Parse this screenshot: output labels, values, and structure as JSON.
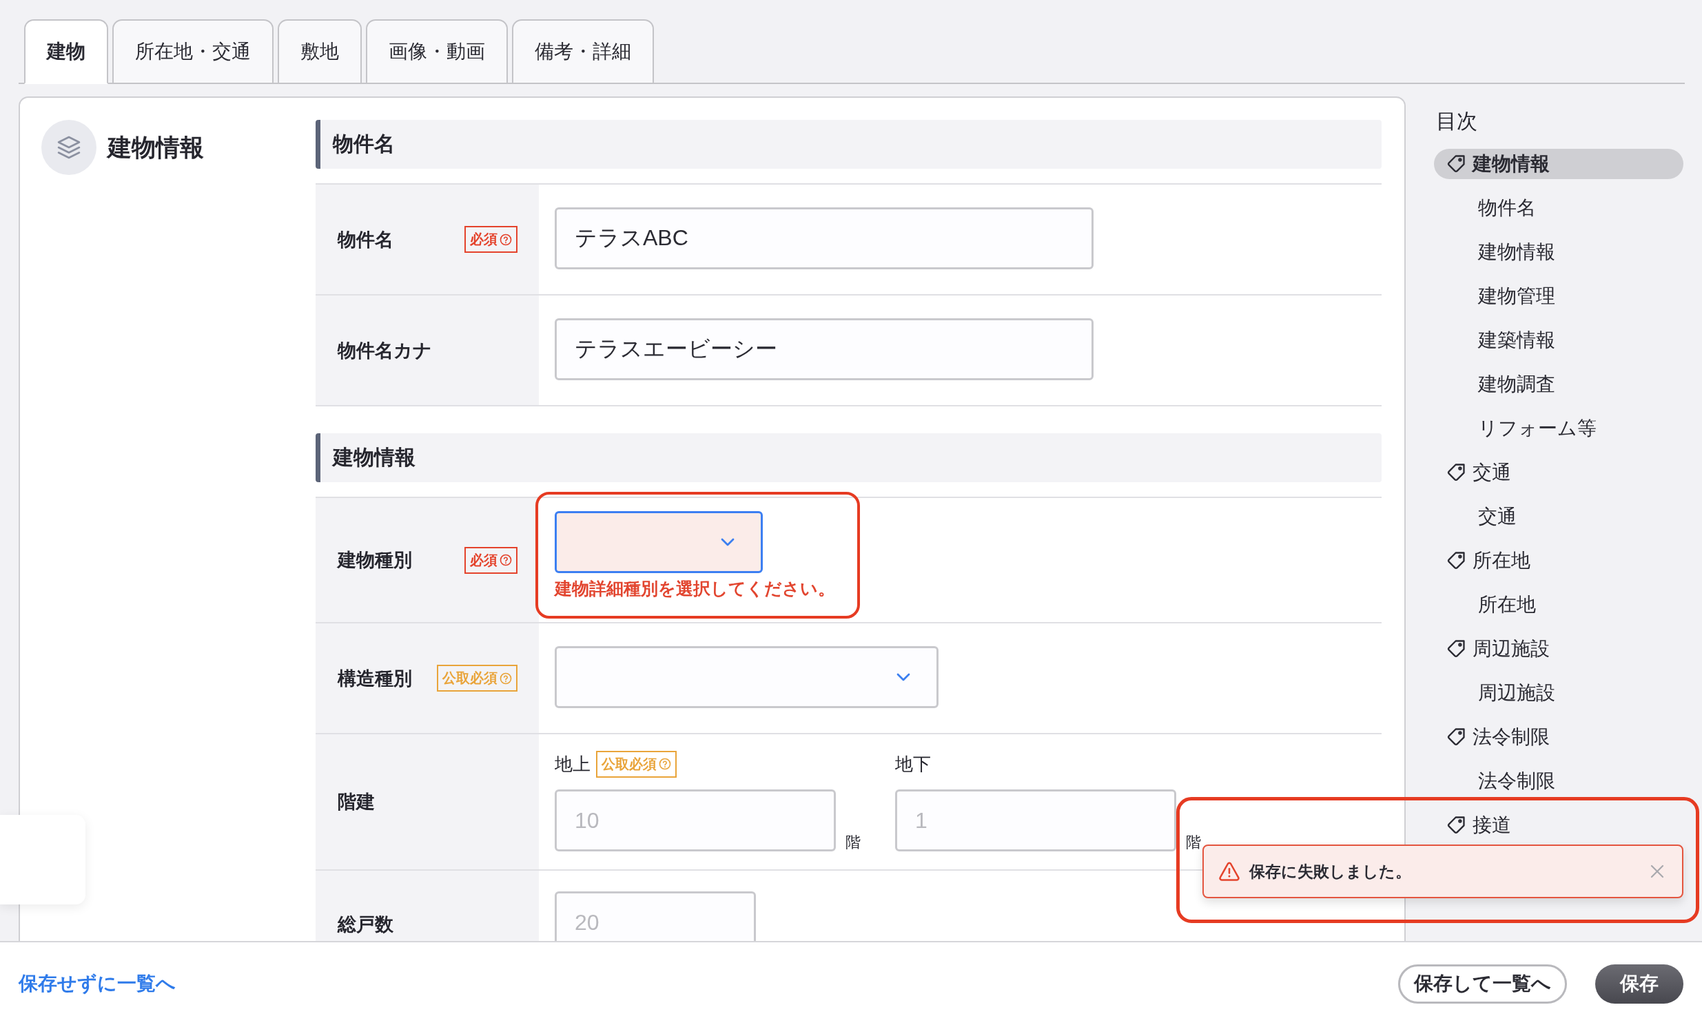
{
  "tabs": [
    {
      "label": "建物",
      "selected": true
    },
    {
      "label": "所在地・交通",
      "selected": false
    },
    {
      "label": "敷地",
      "selected": false
    },
    {
      "label": "画像・動画",
      "selected": false
    },
    {
      "label": "備考・詳細",
      "selected": false
    }
  ],
  "panel": {
    "title": "建物情報"
  },
  "sections": [
    {
      "title": "物件名",
      "fields": [
        {
          "kind": "text",
          "label": "物件名",
          "badge": {
            "kind": "required",
            "text": "必須"
          },
          "value": "テラスABC",
          "highlighted": false
        },
        {
          "kind": "text",
          "label": "物件名カナ",
          "value": "テラスエービーシー",
          "highlighted": false
        }
      ]
    },
    {
      "title": "建物情報",
      "fields": [
        {
          "kind": "select",
          "label": "建物種別",
          "badge": {
            "kind": "required",
            "text": "必須"
          },
          "focused": true,
          "invalid": true,
          "error_message": "建物詳細種別を選択してください。",
          "highlighted": true
        },
        {
          "kind": "select",
          "label": "構造種別",
          "badge": {
            "kind": "public",
            "text": "公取必須"
          },
          "focused": false,
          "invalid": false,
          "highlighted": false
        },
        {
          "kind": "floors",
          "label": "階建",
          "highlighted": false,
          "parts": [
            {
              "label": "地上",
              "badge": {
                "kind": "public",
                "text": "公取必須"
              },
              "placeholder": "10",
              "unit": "階"
            },
            {
              "label": "地下",
              "placeholder": "1",
              "unit": "階"
            }
          ]
        },
        {
          "kind": "number",
          "label": "総戸数",
          "placeholder": "20",
          "highlighted": false
        }
      ]
    }
  ],
  "toc": {
    "title": "目次",
    "items": [
      {
        "label": "建物情報",
        "selected": true,
        "children": [
          {
            "label": "物件名",
            "selected": false
          },
          {
            "label": "建物情報",
            "selected": false
          },
          {
            "label": "建物管理",
            "selected": false
          },
          {
            "label": "建築情報",
            "selected": false
          },
          {
            "label": "建物調査",
            "selected": false
          },
          {
            "label": "リフォーム等",
            "selected": false
          }
        ]
      },
      {
        "label": "交通",
        "selected": false,
        "children": [
          {
            "label": "交通",
            "selected": false
          }
        ]
      },
      {
        "label": "所在地",
        "selected": false,
        "children": [
          {
            "label": "所在地",
            "selected": false
          }
        ]
      },
      {
        "label": "周辺施設",
        "selected": false,
        "children": [
          {
            "label": "周辺施設",
            "selected": false
          }
        ]
      },
      {
        "label": "法令制限",
        "selected": false,
        "children": [
          {
            "label": "法令制限",
            "selected": false
          }
        ]
      },
      {
        "label": "接道",
        "selected": false
      }
    ]
  },
  "footer": {
    "link": "保存せずに一覧へ",
    "buttons": [
      {
        "kind": "secondary",
        "label": "保存して一覧へ"
      },
      {
        "kind": "primary",
        "label": "保存"
      }
    ]
  },
  "toast": {
    "message": "保存に失敗しました。",
    "highlighted": true
  }
}
